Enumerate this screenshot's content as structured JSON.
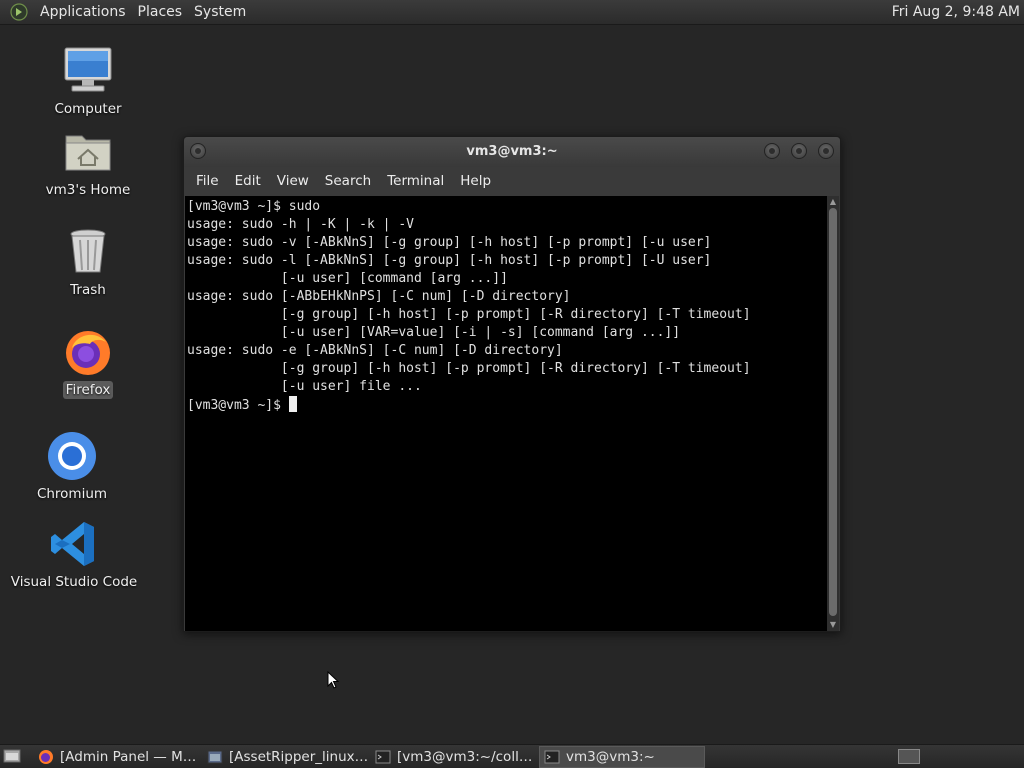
{
  "top_panel": {
    "menus": [
      "Applications",
      "Places",
      "System"
    ],
    "clock": "Fri Aug  2,  9:48 AM"
  },
  "desktop": {
    "icons": [
      {
        "label": "Computer",
        "icon": "computer-icon"
      },
      {
        "label": "vm3's Home",
        "icon": "home-folder-icon"
      },
      {
        "label": "Trash",
        "icon": "trash-icon"
      },
      {
        "label": "Firefox",
        "icon": "firefox-icon",
        "selected": true
      },
      {
        "label": "Chromium",
        "icon": "chromium-icon"
      },
      {
        "label": "Visual Studio Code",
        "icon": "vscode-icon"
      }
    ]
  },
  "terminal": {
    "title": "vm3@vm3:~",
    "menus": [
      "File",
      "Edit",
      "View",
      "Search",
      "Terminal",
      "Help"
    ],
    "lines": [
      "[vm3@vm3 ~]$ sudo",
      "usage: sudo -h | -K | -k | -V",
      "usage: sudo -v [-ABkNnS] [-g group] [-h host] [-p prompt] [-u user]",
      "usage: sudo -l [-ABkNnS] [-g group] [-h host] [-p prompt] [-U user]",
      "            [-u user] [command [arg ...]]",
      "usage: sudo [-ABbEHkNnPS] [-C num] [-D directory]",
      "            [-g group] [-h host] [-p prompt] [-R directory] [-T timeout]",
      "            [-u user] [VAR=value] [-i | -s] [command [arg ...]]",
      "usage: sudo -e [-ABkNnS] [-C num] [-D directory]",
      "            [-g group] [-h host] [-p prompt] [-R directory] [-T timeout]",
      "            [-u user] file ..."
    ],
    "prompt": "[vm3@vm3 ~]$ "
  },
  "taskbar": {
    "tasks": [
      {
        "label": "[Admin Panel — Mo...",
        "icon": "firefox-icon"
      },
      {
        "label": "[AssetRipper_linux_...",
        "icon": "app-window-icon"
      },
      {
        "label": "[vm3@vm3:~/colla...",
        "icon": "terminal-icon"
      },
      {
        "label": "vm3@vm3:~",
        "icon": "terminal-icon",
        "active": true
      }
    ]
  },
  "colors": {
    "desktop_bg": "#262626",
    "terminal_bg": "#000000",
    "terminal_fg": "#e0e0e0"
  }
}
